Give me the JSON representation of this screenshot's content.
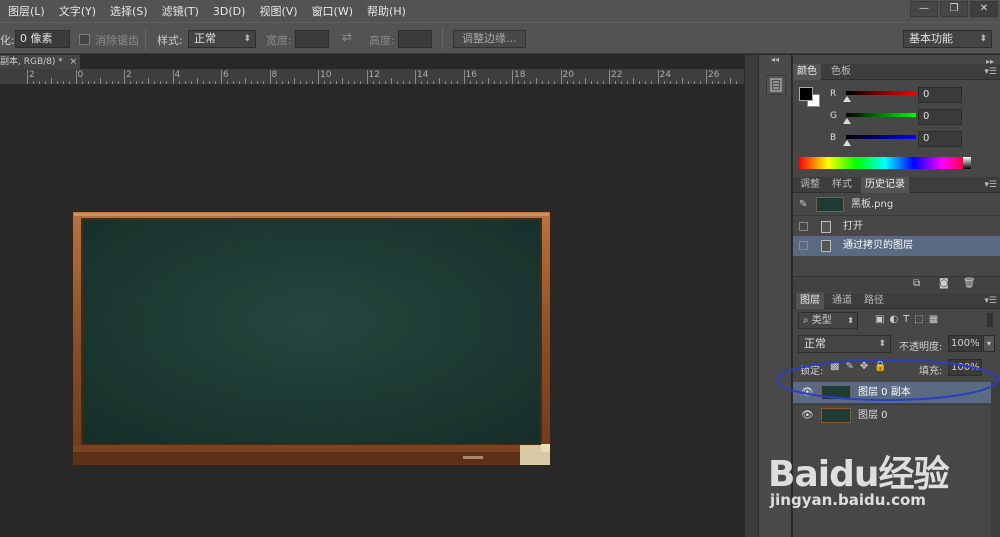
{
  "menubar": {
    "items": [
      "图层(L)",
      "文字(Y)",
      "选择(S)",
      "滤镜(T)",
      "3D(D)",
      "视图(V)",
      "窗口(W)",
      "帮助(H)"
    ],
    "window_controls": [
      "—",
      "❐",
      "✕"
    ]
  },
  "options": {
    "feather_label": "化:",
    "feather_value": "0 像素",
    "antialias_label": "消除锯齿",
    "style_label": "样式:",
    "style_value": "正常",
    "width_label": "宽度:",
    "height_label": "高度:",
    "refine_edge_label": "调整边缘...",
    "workspace_value": "基本功能"
  },
  "document": {
    "tab_title": "副本, RGB/8) *",
    "tab_close": "×",
    "ruler_labels": [
      "2",
      "0",
      "2",
      "4",
      "6",
      "8",
      "10",
      "12",
      "14",
      "16",
      "18",
      "20",
      "22",
      "24",
      "26"
    ]
  },
  "color_panel": {
    "tabs": [
      "颜色",
      "色板"
    ],
    "channels": [
      {
        "label": "R",
        "value": "0",
        "color": "#e00000"
      },
      {
        "label": "G",
        "value": "0",
        "color": "#00c000"
      },
      {
        "label": "B",
        "value": "0",
        "color": "#0000e0"
      }
    ],
    "foreground_color": "#000000",
    "background_color": "#ffffff"
  },
  "history_panel": {
    "tabs": [
      "调整",
      "样式",
      "历史记录"
    ],
    "snapshot_name": "黑板.png",
    "items": [
      {
        "label": "打开",
        "selected": false
      },
      {
        "label": "通过拷贝的图层",
        "selected": true
      }
    ]
  },
  "layers_panel": {
    "tabs": [
      "图层",
      "通道",
      "路径"
    ],
    "filter_value": "类型",
    "blend_mode": "正常",
    "opacity_label": "不透明度:",
    "opacity_value": "100%",
    "lock_label": "锁定:",
    "fill_label": "填充:",
    "fill_value": "100%",
    "layers": [
      {
        "name": "图层 0 副本",
        "active": true,
        "visible": true
      },
      {
        "name": "图层 0",
        "active": false,
        "visible": true
      }
    ]
  },
  "annotation": {
    "circle_color": "#2a3fbf"
  },
  "watermark": {
    "brand": "Baidu经验",
    "url": "jingyan.baidu.com"
  }
}
